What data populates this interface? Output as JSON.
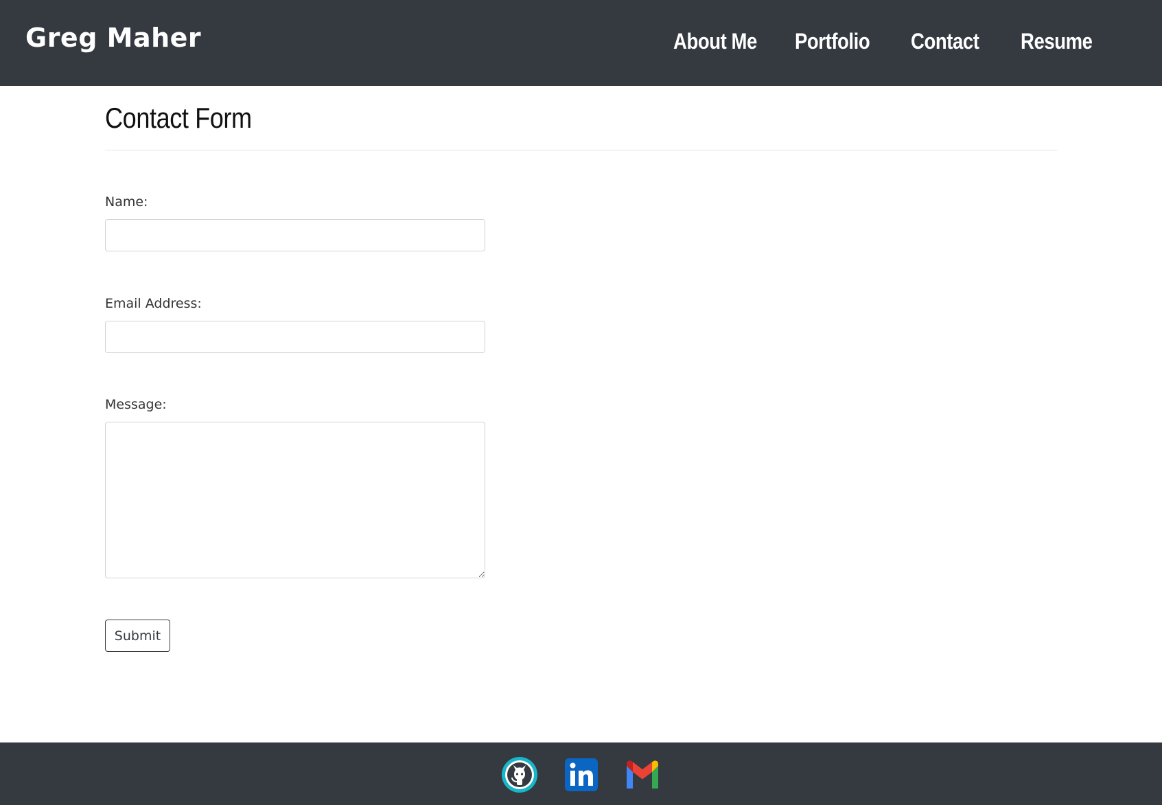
{
  "header": {
    "brand": "Greg Maher",
    "nav": [
      {
        "label": "About Me"
      },
      {
        "label": "Portfolio"
      },
      {
        "label": "Contact"
      },
      {
        "label": "Resume"
      }
    ],
    "background": "#343a40"
  },
  "main": {
    "title": "Contact Form",
    "form": {
      "name_label": "Name:",
      "name_value": "",
      "email_label": "Email Address:",
      "email_value": "",
      "message_label": "Message:",
      "message_value": "",
      "submit_label": "Submit"
    }
  },
  "footer": {
    "background": "#343a40",
    "social": [
      {
        "icon": "github-icon"
      },
      {
        "icon": "linkedin-icon"
      },
      {
        "icon": "gmail-icon"
      }
    ]
  }
}
